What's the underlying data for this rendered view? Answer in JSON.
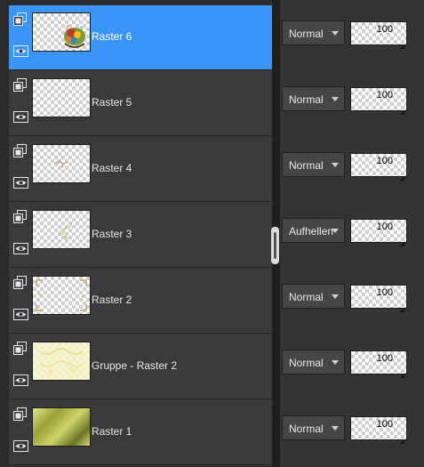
{
  "layers_panel": {
    "layers": [
      {
        "name": "Raster 6",
        "selected": true,
        "thumbnail": "egg-basket-art",
        "blend_mode": "Normal",
        "opacity": "100",
        "icon": "layer-stack-icon",
        "visibility_icon": "eye-icon"
      },
      {
        "name": "Raster 5",
        "selected": false,
        "thumbnail": "transparent",
        "blend_mode": "Normal",
        "opacity": "100",
        "icon": "layer-stack-icon",
        "visibility_icon": "eye-icon"
      },
      {
        "name": "Raster 4",
        "selected": false,
        "thumbnail": "small-sketch",
        "blend_mode": "Normal",
        "opacity": "100",
        "icon": "layer-stack-icon",
        "visibility_icon": "eye-icon"
      },
      {
        "name": "Raster 3",
        "selected": false,
        "thumbnail": "faint-flowers",
        "blend_mode": "Aufhellen",
        "opacity": "100",
        "icon": "layer-stack-icon",
        "visibility_icon": "eye-icon"
      },
      {
        "name": "Raster 2",
        "selected": false,
        "thumbnail": "corner-frame",
        "blend_mode": "Normal",
        "opacity": "100",
        "icon": "layer-stack-icon",
        "visibility_icon": "eye-icon"
      },
      {
        "name": "Gruppe - Raster 2",
        "selected": false,
        "thumbnail": "yellow-pattern",
        "blend_mode": "Normal",
        "opacity": "100",
        "icon": "layer-stack-icon",
        "visibility_icon": "eye-icon"
      },
      {
        "name": "Raster 1",
        "selected": false,
        "thumbnail": "gold-gradient",
        "blend_mode": "Normal",
        "opacity": "100",
        "icon": "layer-stack-icon",
        "visibility_icon": "eye-icon"
      }
    ]
  },
  "colors": {
    "selected_row": "#3b94f7",
    "row_bg": "#3a3a3a",
    "props_bg": "#333333",
    "dropdown_bg": "#464646"
  }
}
